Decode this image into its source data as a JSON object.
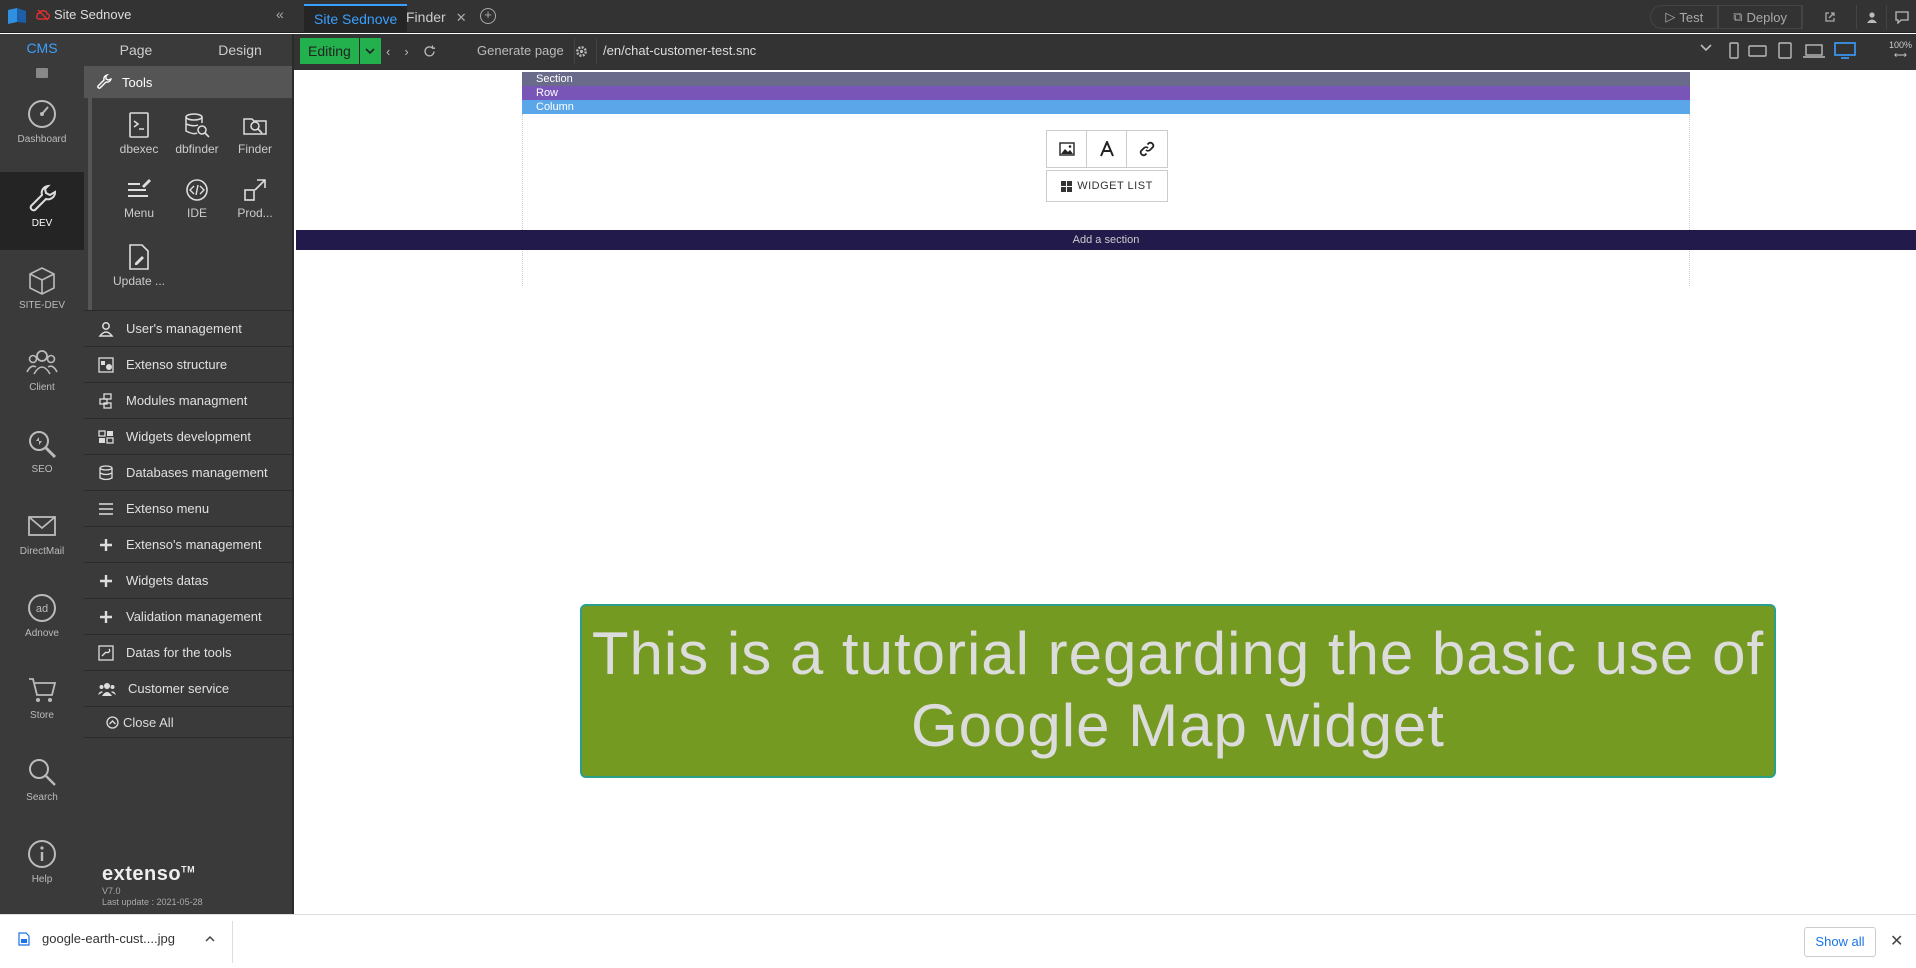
{
  "app": {
    "site_title": "Site Sednove"
  },
  "tabs": [
    {
      "label": "Site Sednove"
    },
    {
      "label": "Finder"
    }
  ],
  "topright": {
    "test_label": "Test",
    "deploy_label": "Deploy"
  },
  "toolbar": {
    "mode_label": "Editing",
    "generate_page_label": "Generate page",
    "url": "/en/chat-customer-test.snc",
    "zoom_label": "100%"
  },
  "leftnav": {
    "cms_label": "CMS",
    "items": [
      {
        "label": "Dashboard",
        "icon": "dashboard-icon"
      },
      {
        "label": "DEV",
        "icon": "wrench-icon"
      },
      {
        "label": "SITE-DEV",
        "icon": "cube-icon"
      },
      {
        "label": "Client",
        "icon": "users-icon"
      },
      {
        "label": "SEO",
        "icon": "seo-icon"
      },
      {
        "label": "DirectMail",
        "icon": "mail-icon"
      },
      {
        "label": "Adnove",
        "icon": "ad-icon"
      },
      {
        "label": "Store",
        "icon": "cart-icon"
      },
      {
        "label": "Search",
        "icon": "search-icon"
      },
      {
        "label": "Help",
        "icon": "info-icon"
      }
    ]
  },
  "panel": {
    "page_tab": "Page",
    "design_tab": "Design",
    "tools_header": "Tools",
    "tools": [
      {
        "label": "dbexec"
      },
      {
        "label": "dbfinder"
      },
      {
        "label": "Finder"
      },
      {
        "label": "Menu"
      },
      {
        "label": "IDE"
      },
      {
        "label": "Prod..."
      },
      {
        "label": "Update ..."
      }
    ],
    "menu_items": [
      {
        "label": "User's management"
      },
      {
        "label": "Extenso structure"
      },
      {
        "label": "Modules managment"
      },
      {
        "label": "Widgets development"
      },
      {
        "label": "Databases management"
      },
      {
        "label": "Extenso menu"
      },
      {
        "label": "Extenso's management"
      },
      {
        "label": "Widgets datas"
      },
      {
        "label": "Validation management"
      },
      {
        "label": "Datas for the tools"
      },
      {
        "label": "Customer service"
      }
    ],
    "close_all": "Close All",
    "brand_name": "extenso",
    "brand_tm": "TM",
    "version": "V7.0",
    "last_update": "Last update : 2021-05-28"
  },
  "canvas": {
    "section_label": "Section",
    "row_label": "Row",
    "column_label": "Column",
    "widget_list_label": "WIDGET LIST",
    "add_section_label": "Add a section",
    "banner_text": "This is a tutorial regarding the basic use of Google Map widget"
  },
  "downloads": {
    "file_name": "google-earth-cust....jpg",
    "show_all_label": "Show all"
  },
  "colors": {
    "accent": "#3aa0ff",
    "editing": "#22b14c",
    "banner": "#759a22"
  }
}
